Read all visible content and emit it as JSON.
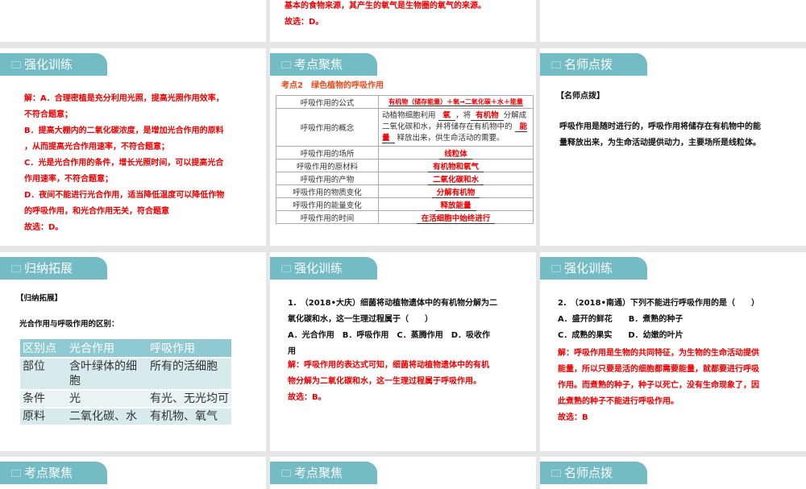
{
  "slides": {
    "top_middle": {
      "lines": [
        "基本的食物来源，其产生的氧气是生物圈的氧气的来源。",
        "故选：D。"
      ]
    },
    "s1": {
      "tab": "强化训练",
      "lines": [
        "解：A．合理密植是充分利用光照，提高光照作用效率，",
        "不符合题意；",
        "B．提高大棚内的二氧化碳浓度，是增加光合作用的原料",
        "，从而提高光合作用速率，不符合题意；",
        "C．光是光合作用的条件，增长光照时间，可以提高光合",
        "作用速率，不符合题意；",
        "D．夜间不能进行光合作用，适当降低温度可以降低作物",
        "的呼吸作用，和光合作用无关，符合题意",
        "故选：D。"
      ]
    },
    "s2": {
      "tab": "考点聚焦",
      "heading": "考点2　绿色植物的呼吸作用",
      "formula_label": "呼吸作用的公式",
      "formula": "有机物（储存能量）＋氧→二氧化碳＋水＋能量",
      "concept_label": "呼吸作用的概念",
      "concept": {
        "p1": "动植物细胞利用",
        "b1": "氧",
        "p2": "，将",
        "b2": "有机物",
        "p3": "分解成二氧化碳和水，并将储存在有机物中的",
        "b3": "能量",
        "p4": "释放出来，供生命活动的需要。"
      },
      "rows": [
        {
          "label": "呼吸作用的场所",
          "value": "线粒体"
        },
        {
          "label": "呼吸作用的原材料",
          "value": "有机物和氧气"
        },
        {
          "label": "呼吸作用的产物",
          "value": "二氧化碳和水"
        },
        {
          "label": "呼吸作用的物质变化",
          "value": "分解有机物"
        },
        {
          "label": "呼吸作用的能量变化",
          "value": "释放能量"
        },
        {
          "label": "呼吸作用的时间",
          "value": "在活细胞中始终进行"
        }
      ]
    },
    "s3": {
      "tab": "名师点拨",
      "heading": "【名师点拨】",
      "lines": [
        "呼吸作用是随时进行的，呼吸作用将储存在有机物中的能",
        "量释放出来，为生命活动提供动力，主要场所是线粒体。"
      ]
    },
    "s4": {
      "tab": "归纳拓展",
      "heading": "【归纳拓展】",
      "subtitle": "光合作用与呼吸作用的区别：",
      "headers": [
        "区别点",
        "光合作用",
        "呼吸作用"
      ],
      "rows": [
        [
          "部位",
          "含叶绿体的细胞",
          "所有的活细胞"
        ],
        [
          "条件",
          "光",
          "有光、无光均可"
        ],
        [
          "原料",
          "二氧化碳、水",
          "有机物、氧气"
        ]
      ]
    },
    "s5": {
      "tab": "强化训练",
      "question": [
        "1.　（2018•大庆）细菌将动植物遗体中的有机物分解为二",
        "氧化碳和水，这一生理过程属于（　　）",
        "A．光合作用　B．呼吸作用　C．蒸腾作用　D．吸收作",
        "用"
      ],
      "answer": [
        "解：呼吸作用的表达式可知，细菌将动植物遗体中的有机",
        "物分解为二氧化碳和水，这一生理过程属于呼吸作用。",
        "故选：B。"
      ]
    },
    "s6": {
      "tab": "强化训练",
      "question": [
        "2.　（2018•南通）下列不能进行呼吸作用的是（　　）",
        "A．盛开的鲜花　　B．煮熟的种子",
        "C．成熟的果实　　D．幼嫩的叶片"
      ],
      "answer": [
        "解：呼吸作用是生物的共同特征，为生物的生命活动提供",
        "能量，所以只要是活的细胞都需要能量，就都要进行呼吸",
        "作用。而煮熟的种子，种子以死亡，没有生命现象了，因",
        "此煮熟的种子不能进行呼吸作用。",
        "故选：B"
      ]
    },
    "s7": {
      "tab": "考点聚焦"
    },
    "s8": {
      "tab": "考点聚焦"
    },
    "s9": {
      "tab": "名师点拨"
    }
  }
}
